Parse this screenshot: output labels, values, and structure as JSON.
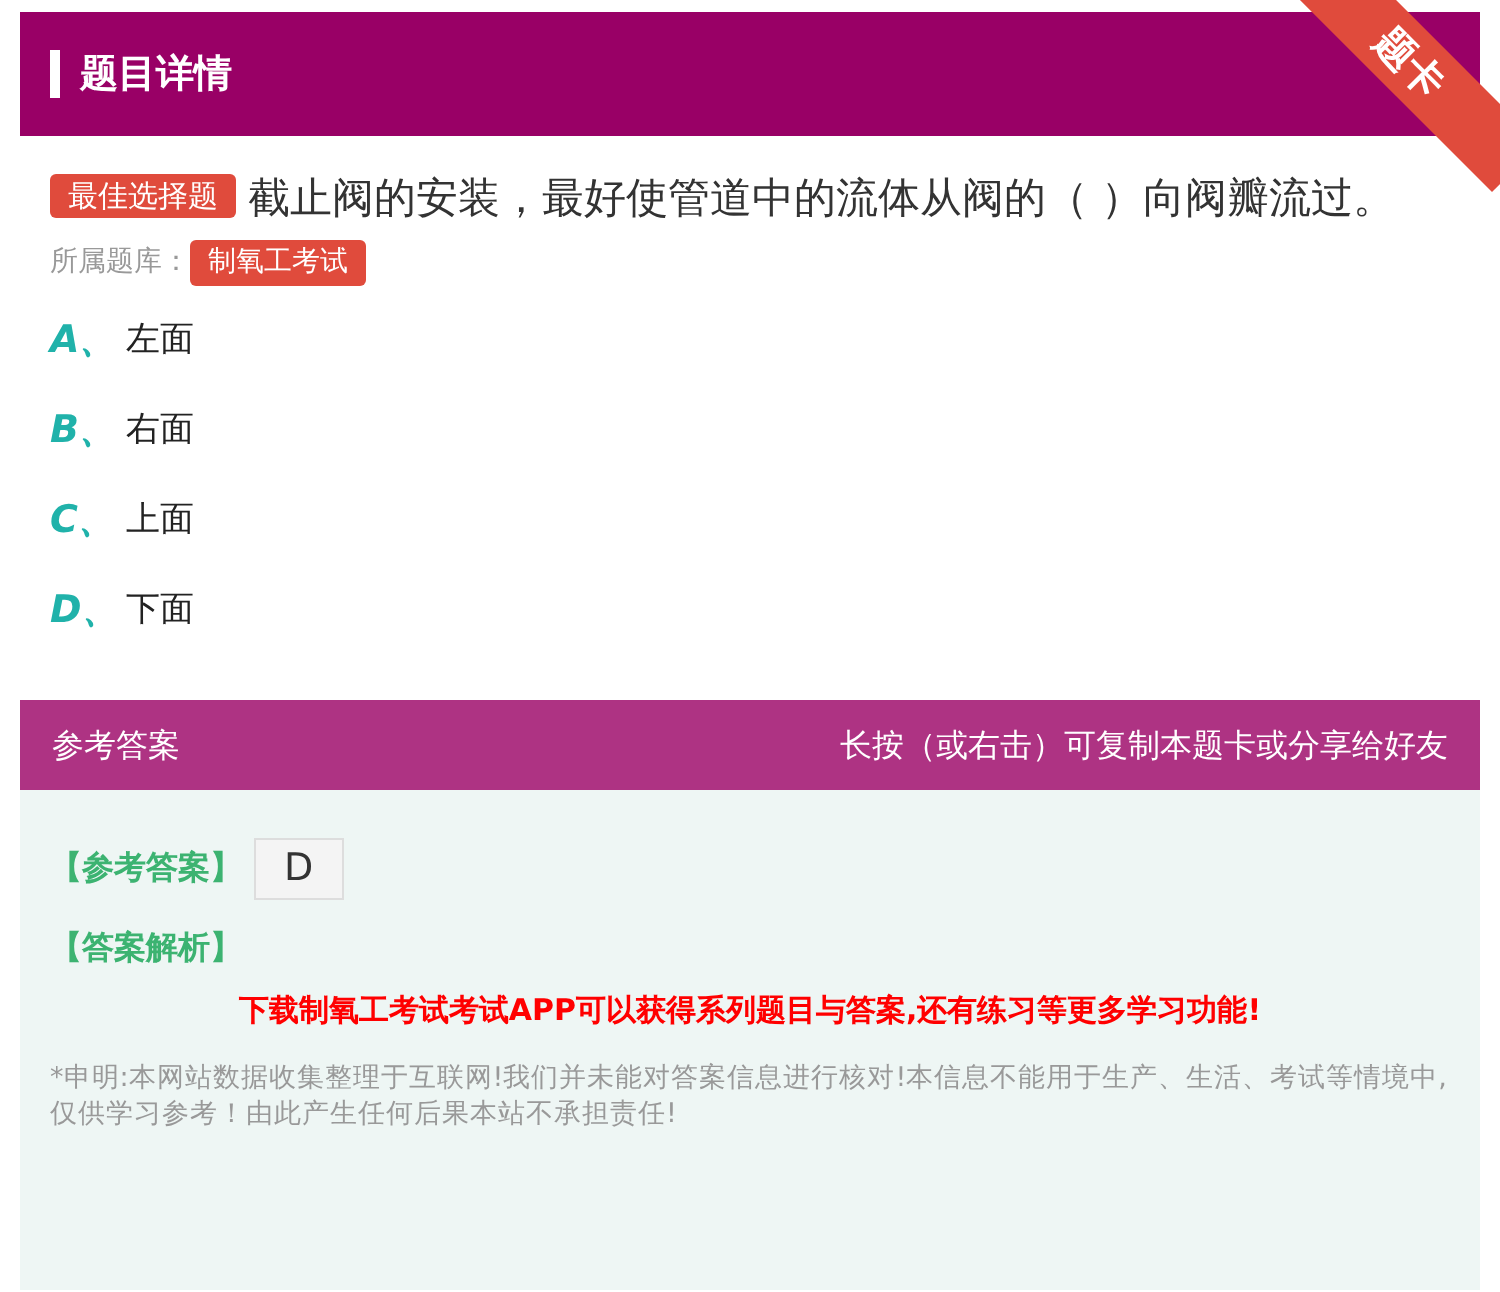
{
  "header": {
    "title": "题目详情",
    "corner_badge": "题卡"
  },
  "question": {
    "type_badge": "最佳选择题",
    "text": "截止阀的安装，最好使管道中的流体从阀的（ ）向阀瓣流过。",
    "bank_label": "所属题库：",
    "bank": "制氧工考试"
  },
  "options": [
    {
      "letter": "A、",
      "text": "左面"
    },
    {
      "letter": "B、",
      "text": "右面"
    },
    {
      "letter": "C、",
      "text": "上面"
    },
    {
      "letter": "D、",
      "text": "下面"
    }
  ],
  "answer_bar": {
    "title": "参考答案",
    "hint": "长按（或右击）可复制本题卡或分享给好友"
  },
  "answer": {
    "label": "【参考答案】",
    "value": "D",
    "analysis_label": "【答案解析】",
    "promo": "下载制氧工考试考试APP可以获得系列题目与答案,还有练习等更多学习功能!",
    "disclaimer": "*申明:本网站数据收集整理于互联网!我们并未能对答案信息进行核对!本信息不能用于生产、生活、考试等情境中,仅供学习参考！由此产生任何后果本站不承担责任!"
  }
}
